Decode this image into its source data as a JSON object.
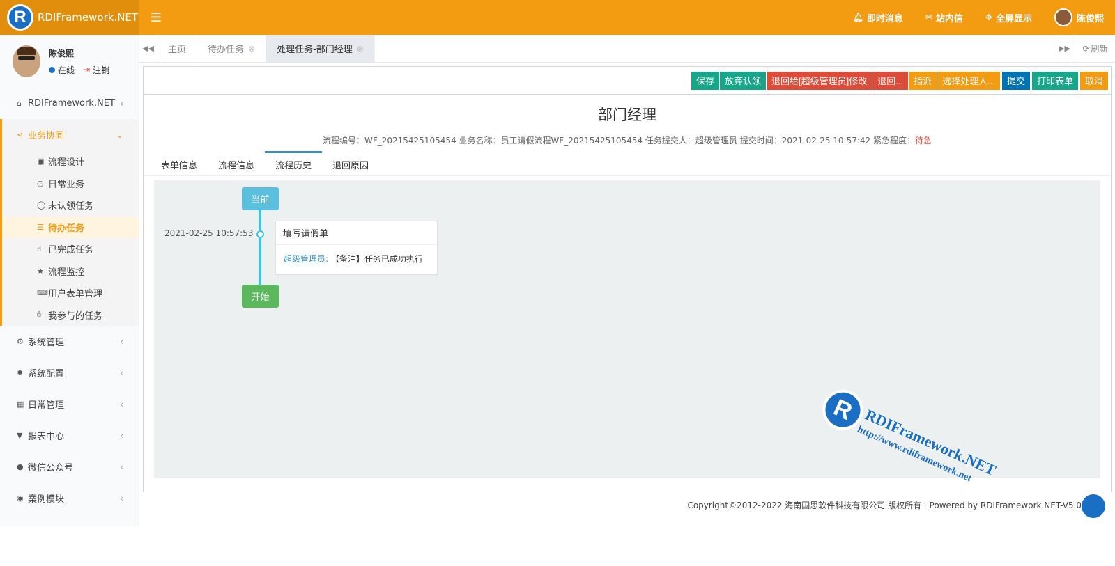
{
  "app": {
    "logo_text": "RDIFramework.NET",
    "logo_letter": "R"
  },
  "topbar": {
    "menu_icon": "☰",
    "instant_msg": "即时消息",
    "inbox": "站内信",
    "fullscreen": "全屏显示",
    "user": "陈俊熙"
  },
  "user_panel": {
    "name": "陈俊熙",
    "status": "在线",
    "logout": "注销"
  },
  "sidebar": {
    "items": [
      {
        "label": "RDIFramework.NET",
        "icon": "home-icon"
      },
      {
        "label": "业务协同",
        "icon": "share-icon"
      },
      {
        "label": "系统管理",
        "icon": "cogs-icon"
      },
      {
        "label": "系统配置",
        "icon": "gear-icon"
      },
      {
        "label": "日常管理",
        "icon": "calendar-icon"
      },
      {
        "label": "报表中心",
        "icon": "filter-icon"
      },
      {
        "label": "微信公众号",
        "icon": "wechat-icon"
      },
      {
        "label": "案例模块",
        "icon": "eye-icon"
      }
    ],
    "sub_items": [
      {
        "label": "流程设计",
        "icon": "edit-icon"
      },
      {
        "label": "日常业务",
        "icon": "clock-icon"
      },
      {
        "label": "未认领任务",
        "icon": "circle-icon"
      },
      {
        "label": "待办任务",
        "icon": "tasks-icon"
      },
      {
        "label": "已完成任务",
        "icon": "hand-icon"
      },
      {
        "label": "流程监控",
        "icon": "star-icon"
      },
      {
        "label": "用户表单管理",
        "icon": "keyboard-icon"
      },
      {
        "label": "我参与的任务",
        "icon": "hand-paper-icon"
      }
    ]
  },
  "tabs": {
    "home": "主页",
    "todo": "待办任务",
    "current": "处理任务-部门经理",
    "refresh": "刷新"
  },
  "toolbar": {
    "save": "保存",
    "abandon": "放弃认领",
    "return_to": "退回给[超级管理员]修改",
    "return": "退回...",
    "assign": "指派",
    "select_handler": "选择处理人...",
    "submit": "提交",
    "print": "打印表单",
    "cancel": "取消"
  },
  "form": {
    "title": "部门经理",
    "meta": "流程编号：WF_20215425105454 业务名称：员工请假流程WF_20215425105454 任务提交人：超级管理员 提交时间：2021-02-25 10:57:42 紧急程度：",
    "urgency": "待急"
  },
  "inner_tabs": [
    "表单信息",
    "流程信息",
    "流程历史",
    "退回原因"
  ],
  "timeline": {
    "current_label": "当前",
    "start_label": "开始",
    "time": "2021-02-25 10:57:53",
    "card_title": "填写请假单",
    "card_who": "超级管理员:",
    "card_text": "【备注】任务已成功执行"
  },
  "watermark": {
    "letter": "R",
    "title": "RDIFramework.NET",
    "url": "http://www.rdiframework.net"
  },
  "footer": {
    "text": "Copyright©2012-2022 海南国思软件科技有限公司 版权所有 · Powered by RDIFramework.NET-V5.0"
  }
}
